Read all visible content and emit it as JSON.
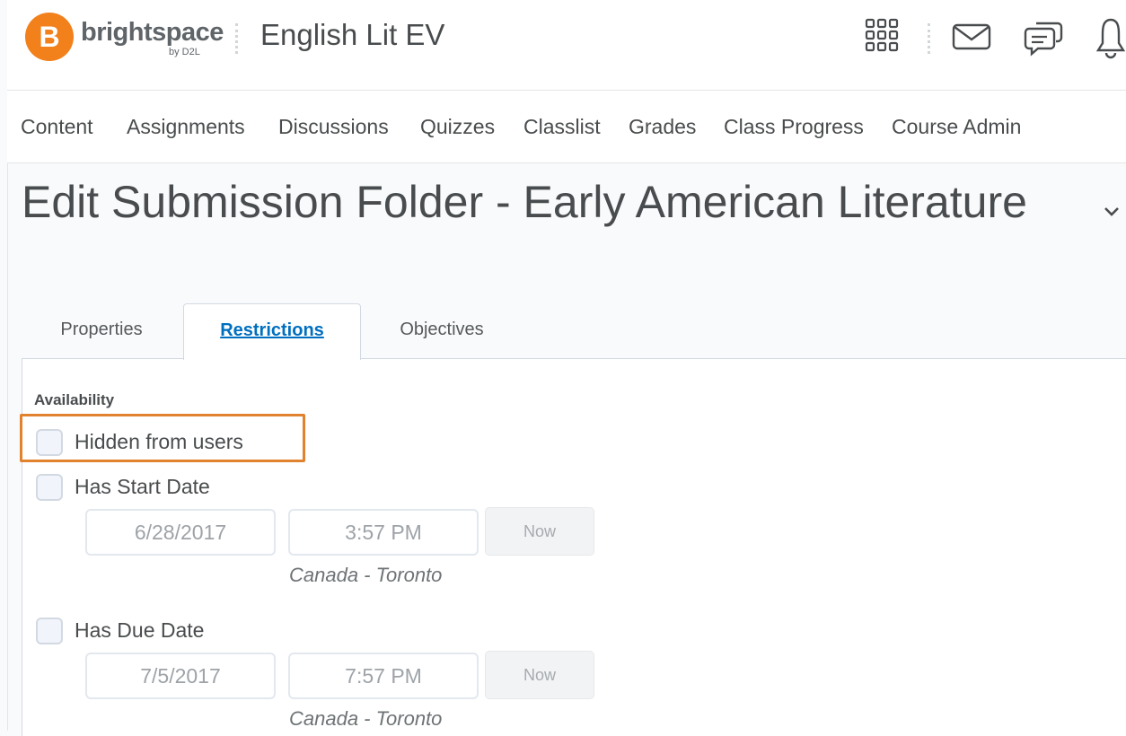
{
  "brand": {
    "logo_letter": "B",
    "logo_word": "brightspace",
    "logo_sub": "by D2L",
    "accent_color": "#f2801b"
  },
  "header": {
    "course_title": "English Lit EV",
    "icons": [
      "app-grid-icon",
      "mail-icon",
      "chat-icon",
      "bell-icon"
    ]
  },
  "nav": {
    "items": [
      "Content",
      "Assignments",
      "Discussions",
      "Quizzes",
      "Classlist",
      "Grades",
      "Class Progress",
      "Course Admin"
    ]
  },
  "page": {
    "title": "Edit Submission Folder - Early American Literature"
  },
  "tabs": {
    "items": [
      "Properties",
      "Restrictions",
      "Objectives"
    ],
    "active": "Restrictions"
  },
  "availability": {
    "section_label": "Availability",
    "hidden_label": "Hidden from users",
    "start": {
      "label": "Has Start Date",
      "date": "6/28/2017",
      "time": "3:57 PM",
      "now_label": "Now",
      "timezone": "Canada - Toronto"
    },
    "due": {
      "label": "Has Due Date",
      "date": "7/5/2017",
      "time": "7:57 PM",
      "now_label": "Now",
      "timezone": "Canada - Toronto"
    }
  },
  "colors": {
    "highlight": "#e0822e",
    "active_tab": "#006fbf"
  }
}
